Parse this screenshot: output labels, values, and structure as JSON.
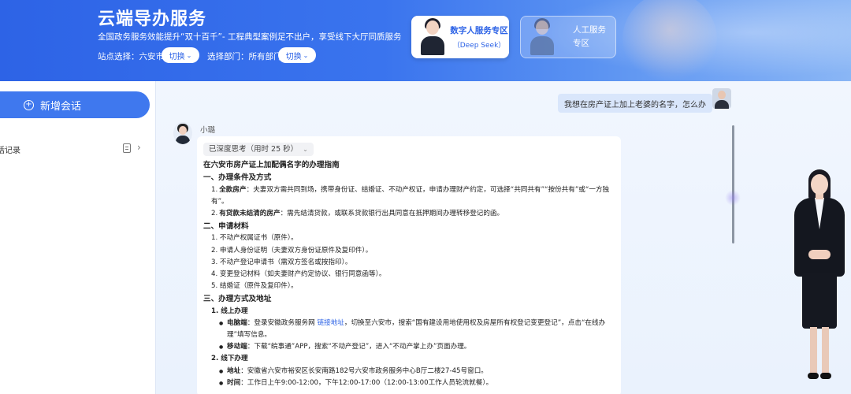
{
  "header": {
    "title": "云端导办服务",
    "subtitle": "全国政务服务效能提升“双十百千”- 工程典型案例足不出户，享受线下大厅同质服务",
    "site_label": "站点选择：六安市",
    "dept_label": "选择部门：所有部门",
    "switch_label": "切换",
    "switch_label_2": "切换",
    "digital_mode": {
      "title": "数字人服务专区",
      "sub": "（Deep Seek）"
    },
    "human_mode": {
      "line1": "人工服务",
      "line2": "专区"
    }
  },
  "sidebar": {
    "new_chat": "新增会话",
    "history": "话记录"
  },
  "chat": {
    "user_message": "我想在房产证上加上老婆的名字，怎么办",
    "bot_name": "小璐",
    "think_label": "已深度思考（用时 25 秒）",
    "answer": {
      "title": "在六安市房产证上加配偶名字的办理指南",
      "s1": "一、办理条件及方式",
      "s1_i1_num": "1.",
      "s1_i1_bold": "全款房产",
      "s1_i1_text": "：夫妻双方需共同到场，携带身份证、结婚证、不动产权证，申请办理财产约定，可选择“共同共有”“按份共有”或“一方独有”。",
      "s1_i2_num": "2.",
      "s1_i2_bold": "有贷款未结清的房产",
      "s1_i2_text": "：需先结清贷款，或联系贷款银行出具同意在抵押期间办理转移登记的函。",
      "s2": "二、申请材料",
      "s2_items": [
        "1. 不动产权属证书（原件）。",
        "2. 申请人身份证明（夫妻双方身份证原件及复印件）。",
        "3. 不动产登记申请书（需双方签名或按指印）。",
        "4. 变更登记材料（如夫妻财产约定协议、银行同意函等）。",
        "5. 结婚证（原件及复印件）。"
      ],
      "s3": "三、办理方式及地址",
      "s3_1": "1. 线上办理",
      "pc_bold": "电脑端",
      "pc_text1": "：登录安徽政务服务网 ",
      "pc_link": "链接地址",
      "pc_text2": "，切换至六安市，搜索“国有建设用地使用权及房屋所有权登记变更登记”，点击“在线办理”填写信息。",
      "mobile_bold": "移动端",
      "mobile_text": "：下载“皖事通”APP，搜索“不动产登记”，进入“不动产掌上办”页面办理。",
      "s3_2": "2. 线下办理",
      "addr_bold": "地址",
      "addr_text": "：安徽省六安市裕安区长安南路182号六安市政务服务中心B厅二楼27-45号窗口。",
      "time_bold": "时间",
      "time_text": "：工作日上午9:00-12:00，下午12:00-17:00（12:00-13:00工作人员轮流就餐）。"
    }
  },
  "colors": {
    "brand": "#2d63e6",
    "accent": "#3f78ee"
  }
}
